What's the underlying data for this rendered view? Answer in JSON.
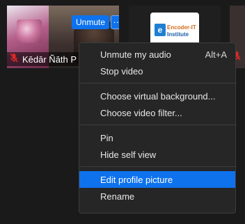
{
  "participants": {
    "self": {
      "name": "Kēdār Ñāth P",
      "mic_state": "muted"
    },
    "self_controls": {
      "unmute_label": "Unmute",
      "more_label": "···"
    },
    "logo_tile": {
      "line1": "Encoder-IT",
      "line2": "Institute",
      "mark": "e"
    }
  },
  "menu": {
    "groups": [
      [
        {
          "label": "Unmute my audio",
          "shortcut": "Alt+A"
        },
        {
          "label": "Stop video"
        }
      ],
      [
        {
          "label": "Choose virtual background..."
        },
        {
          "label": "Choose video filter..."
        }
      ],
      [
        {
          "label": "Pin"
        },
        {
          "label": "Hide self view"
        }
      ],
      [
        {
          "label": "Edit profile picture",
          "selected": true
        },
        {
          "label": "Rename"
        }
      ]
    ]
  },
  "colors": {
    "accent": "#0e72ed",
    "menu_bg": "#262626",
    "muted_icon": "#e02828"
  }
}
